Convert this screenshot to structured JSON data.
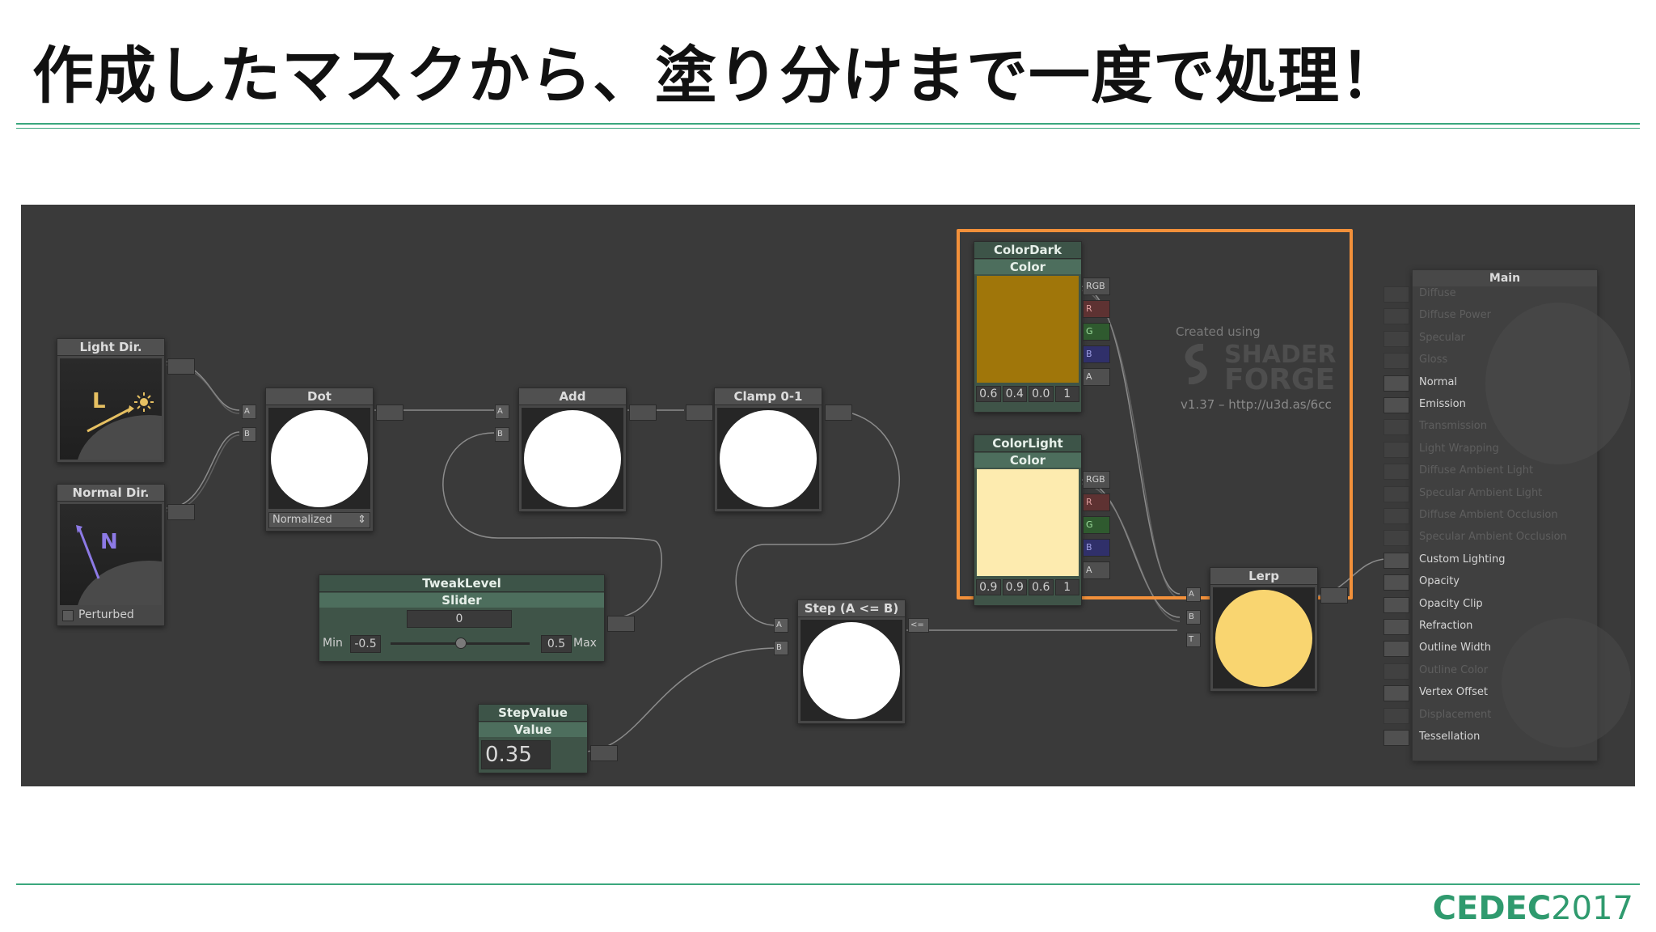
{
  "slide": {
    "title": "作成したマスクから、塗り分けまで一度で処理！",
    "footer_brand": "CEDEC",
    "footer_year": "2017"
  },
  "colors": {
    "accent": "#3aa77d",
    "highlight": "#f2903a",
    "dark_color": "#a0760a",
    "light_color": "#fdebaf",
    "lerp_result": "#f9d570"
  },
  "editor": {
    "nodes": {
      "light_dir": {
        "title": "Light Dir.",
        "glyph": "L"
      },
      "normal_dir": {
        "title": "Normal Dir.",
        "glyph": "N",
        "checkbox": "Perturbed"
      },
      "dot": {
        "title": "Dot",
        "mode": "Normalized",
        "port_a": "A",
        "port_b": "B"
      },
      "add": {
        "title": "Add",
        "port_a": "A",
        "port_b": "B"
      },
      "clamp": {
        "title": "Clamp 0-1"
      },
      "tweak": {
        "title": "TweakLevel",
        "subtitle": "Slider",
        "value": "0",
        "min_label": "Min",
        "min_value": "-0.5",
        "max_value": "0.5",
        "max_label": "Max"
      },
      "step_value": {
        "title": "StepValue",
        "subtitle": "Value",
        "value": "0.35"
      },
      "step": {
        "title": "Step (A <= B)",
        "port_a": "A",
        "port_b": "B",
        "out": "<="
      },
      "color_dark": {
        "title": "ColorDark",
        "subtitle": "Color",
        "values": [
          "0.6",
          "0.4",
          "0.0",
          "1"
        ],
        "channels": [
          "RGB",
          "R",
          "G",
          "B",
          "A"
        ]
      },
      "color_light": {
        "title": "ColorLight",
        "subtitle": "Color",
        "values": [
          "0.9",
          "0.9",
          "0.6",
          "1"
        ],
        "channels": [
          "RGB",
          "R",
          "G",
          "B",
          "A"
        ]
      },
      "lerp": {
        "title": "Lerp",
        "port_a": "A",
        "port_b": "B",
        "port_t": "T"
      }
    },
    "watermark": {
      "created": "Created using",
      "brand_line1": "SHADER",
      "brand_line2": "FORGE",
      "version": "v1.37 – http://u3d.as/6cc"
    },
    "main": {
      "title": "Main",
      "items": [
        {
          "label": "Diffuse",
          "active": false
        },
        {
          "label": "Diffuse Power",
          "active": false
        },
        {
          "label": "Specular",
          "active": false
        },
        {
          "label": "Gloss",
          "active": false
        },
        {
          "label": "Normal",
          "active": true
        },
        {
          "label": "Emission",
          "active": true
        },
        {
          "label": "Transmission",
          "active": false
        },
        {
          "label": "Light Wrapping",
          "active": false
        },
        {
          "label": "Diffuse Ambient Light",
          "active": false
        },
        {
          "label": "Specular Ambient Light",
          "active": false
        },
        {
          "label": "Diffuse Ambient Occlusion",
          "active": false
        },
        {
          "label": "Specular Ambient Occlusion",
          "active": false
        },
        {
          "label": "Custom Lighting",
          "active": true
        },
        {
          "label": "Opacity",
          "active": true
        },
        {
          "label": "Opacity Clip",
          "active": true
        },
        {
          "label": "Refraction",
          "active": true
        },
        {
          "label": "Outline Width",
          "active": true
        },
        {
          "label": "Outline Color",
          "active": false
        },
        {
          "label": "Vertex Offset",
          "active": true
        },
        {
          "label": "Displacement",
          "active": false
        },
        {
          "label": "Tessellation",
          "active": true
        }
      ]
    }
  }
}
